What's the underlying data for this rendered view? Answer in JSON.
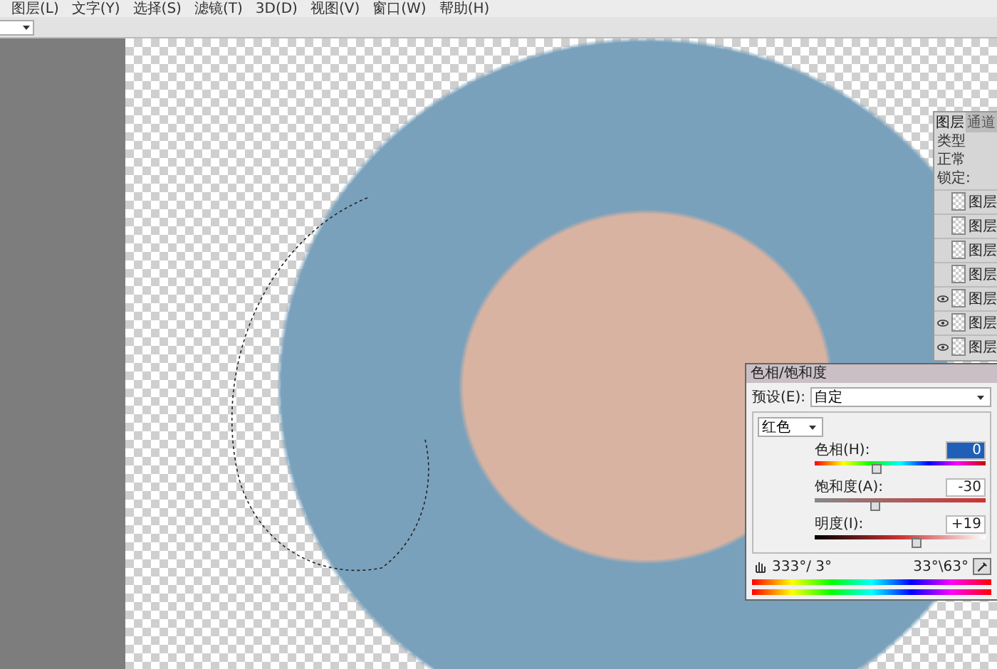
{
  "menu": [
    {
      "label": "图层(L)"
    },
    {
      "label": "文字(Y)"
    },
    {
      "label": "选择(S)"
    },
    {
      "label": "滤镜(T)"
    },
    {
      "label": "3D(D)"
    },
    {
      "label": "视图(V)"
    },
    {
      "label": "窗口(W)"
    },
    {
      "label": "帮助(H)"
    }
  ],
  "layers_panel": {
    "tabs": [
      {
        "label": "图层",
        "selected": true
      },
      {
        "label": "通道",
        "selected": false
      }
    ],
    "kind_filter": "类型",
    "blend_mode": "正常",
    "lock_label": "锁定:",
    "layers": [
      {
        "name": "图层",
        "visible": false
      },
      {
        "name": "图层",
        "visible": false
      },
      {
        "name": "图层",
        "visible": false
      },
      {
        "name": "图层",
        "visible": false
      },
      {
        "name": "图层",
        "visible": true
      },
      {
        "name": "图层",
        "visible": true
      },
      {
        "name": "图层",
        "visible": true
      }
    ]
  },
  "hue_saturation_dialog": {
    "title": "色相/饱和度",
    "preset_label": "预设(E):",
    "preset": "自定",
    "channel": "红色",
    "sliders": [
      {
        "kind": "hue",
        "label": "色相(H):",
        "value": "0",
        "selected": true,
        "level": 0.36
      },
      {
        "kind": "saturation",
        "label": "饱和度(A):",
        "value": "-30",
        "selected": false,
        "level": 0.35
      },
      {
        "kind": "lightness",
        "label": "明度(I):",
        "value": "+19",
        "selected": false,
        "level": 0.59
      }
    ],
    "range_left": "333°/ 3°",
    "range_right": "33°\\63°"
  }
}
